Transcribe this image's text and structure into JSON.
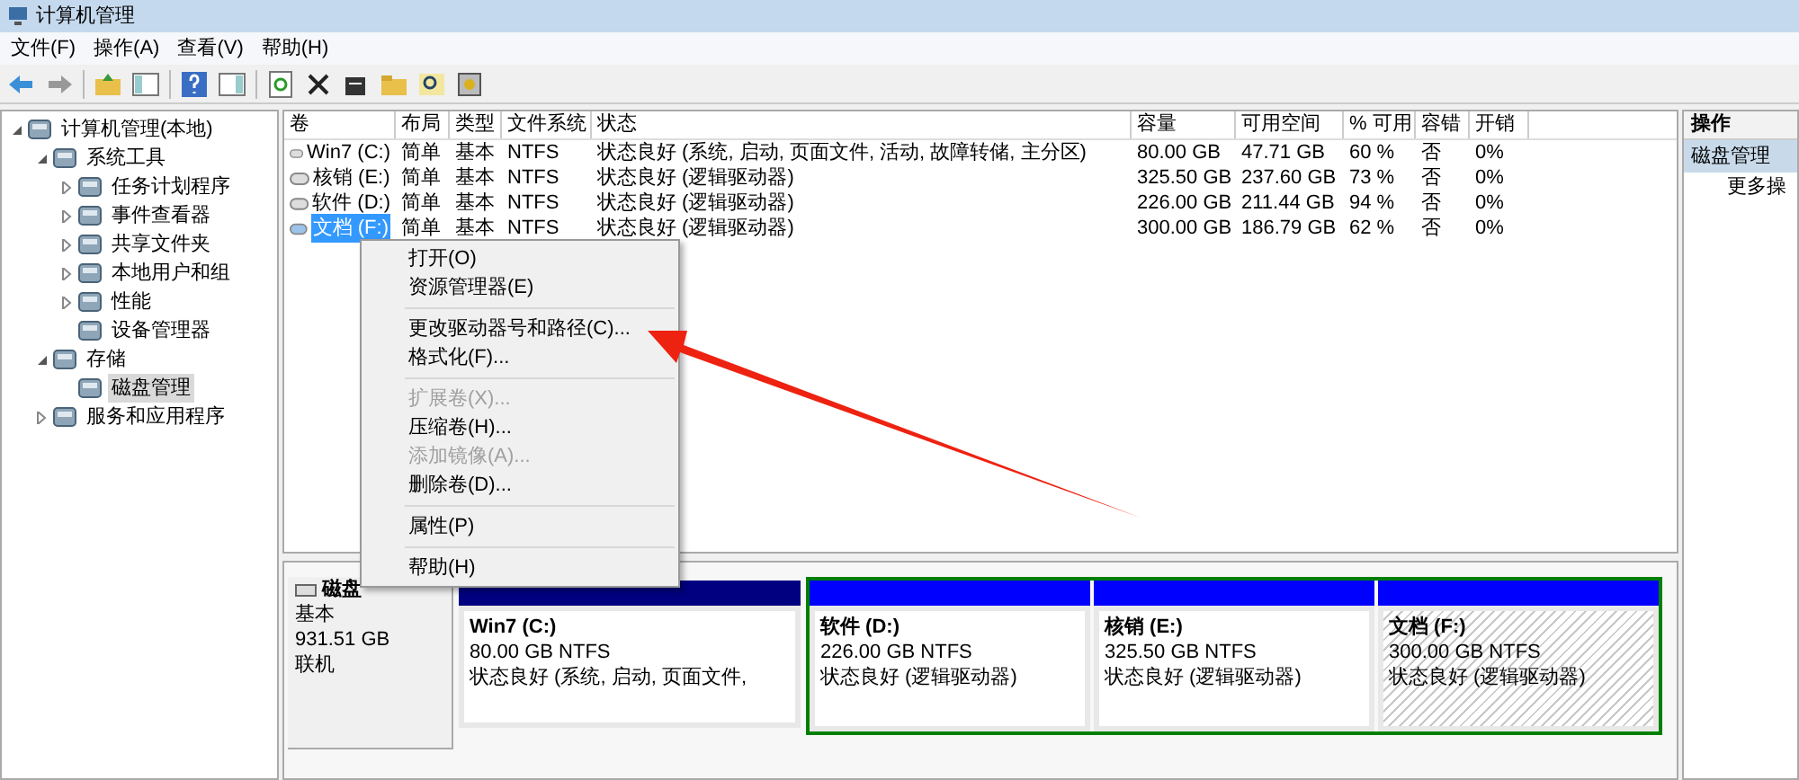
{
  "window": {
    "title": "计算机管理"
  },
  "menu_bar": [
    "文件(F)",
    "操作(A)",
    "查看(V)",
    "帮助(H)"
  ],
  "tree": [
    {
      "label": "计算机管理(本地)",
      "expanded": true,
      "selected": false,
      "children": [
        {
          "label": "系统工具",
          "expanded": true,
          "selected": false,
          "children": [
            {
              "label": "任务计划程序",
              "expanded": false,
              "selected": false
            },
            {
              "label": "事件查看器",
              "expanded": false,
              "selected": false
            },
            {
              "label": "共享文件夹",
              "expanded": false,
              "selected": false
            },
            {
              "label": "本地用户和组",
              "expanded": false,
              "selected": false
            },
            {
              "label": "性能",
              "expanded": false,
              "selected": false
            },
            {
              "label": "设备管理器",
              "selected": false
            }
          ]
        },
        {
          "label": "存储",
          "expanded": true,
          "selected": false,
          "children": [
            {
              "label": "磁盘管理",
              "selected": true
            }
          ]
        },
        {
          "label": "服务和应用程序",
          "expanded": false,
          "selected": false
        }
      ]
    }
  ],
  "table": {
    "columns": [
      "卷",
      "布局",
      "类型",
      "文件系统",
      "状态",
      "容量",
      "可用空间",
      "% 可用",
      "容错",
      "开销"
    ],
    "rows": [
      {
        "selected": false,
        "cells": [
          "Win7 (C:)",
          "简单",
          "基本",
          "NTFS",
          "状态良好 (系统, 启动, 页面文件, 活动, 故障转储, 主分区)",
          "80.00 GB",
          "47.71 GB",
          "60 %",
          "否",
          "0%"
        ]
      },
      {
        "selected": false,
        "cells": [
          "核销 (E:)",
          "简单",
          "基本",
          "NTFS",
          "状态良好 (逻辑驱动器)",
          "325.50 GB",
          "237.60 GB",
          "73 %",
          "否",
          "0%"
        ]
      },
      {
        "selected": false,
        "cells": [
          "软件 (D:)",
          "简单",
          "基本",
          "NTFS",
          "状态良好 (逻辑驱动器)",
          "226.00 GB",
          "211.44 GB",
          "94 %",
          "否",
          "0%"
        ]
      },
      {
        "selected": true,
        "cells": [
          "文档 (F:)",
          "简单",
          "基本",
          "NTFS",
          "状态良好 (逻辑驱动器)",
          "300.00 GB",
          "186.79 GB",
          "62 %",
          "否",
          "0%"
        ]
      }
    ]
  },
  "context_menu": [
    {
      "kind": "item",
      "label": "打开(O)",
      "disabled": false
    },
    {
      "kind": "item",
      "label": "资源管理器(E)",
      "disabled": false
    },
    {
      "kind": "separator"
    },
    {
      "kind": "item",
      "label": "更改驱动器号和路径(C)...",
      "disabled": false
    },
    {
      "kind": "item",
      "label": "格式化(F)...",
      "disabled": false
    },
    {
      "kind": "separator"
    },
    {
      "kind": "item",
      "label": "扩展卷(X)...",
      "disabled": true
    },
    {
      "kind": "item",
      "label": "压缩卷(H)...",
      "disabled": false
    },
    {
      "kind": "item",
      "label": "添加镜像(A)...",
      "disabled": true
    },
    {
      "kind": "item",
      "label": "删除卷(D)...",
      "disabled": false
    },
    {
      "kind": "separator"
    },
    {
      "kind": "item",
      "label": "属性(P)",
      "disabled": false
    },
    {
      "kind": "separator"
    },
    {
      "kind": "item",
      "label": "帮助(H)",
      "disabled": false
    }
  ],
  "disk": {
    "name": "磁盘",
    "type": "基本",
    "size": "931.51 GB",
    "status": "联机",
    "partitions": [
      {
        "kind": "primary",
        "selected": false,
        "name": "Win7  (C:)",
        "size": "80.00 GB NTFS",
        "status": "状态良好 (系统, 启动, 页面文件, "
      },
      {
        "kind": "logical",
        "selected": false,
        "name": "软件  (D:)",
        "size": "226.00 GB NTFS",
        "status": "状态良好 (逻辑驱动器)"
      },
      {
        "kind": "logical",
        "selected": false,
        "name": "核销  (E:)",
        "size": "325.50 GB NTFS",
        "status": "状态良好 (逻辑驱动器)"
      },
      {
        "kind": "logical",
        "selected": true,
        "name": "文档  (F:)",
        "size": "300.00 GB NTFS",
        "status": "状态良好 (逻辑驱动器)"
      }
    ]
  },
  "actions": {
    "title": "操作",
    "items": [
      {
        "label": "磁盘管理",
        "kind": "header"
      },
      {
        "label": "更多操",
        "kind": "link"
      }
    ]
  }
}
